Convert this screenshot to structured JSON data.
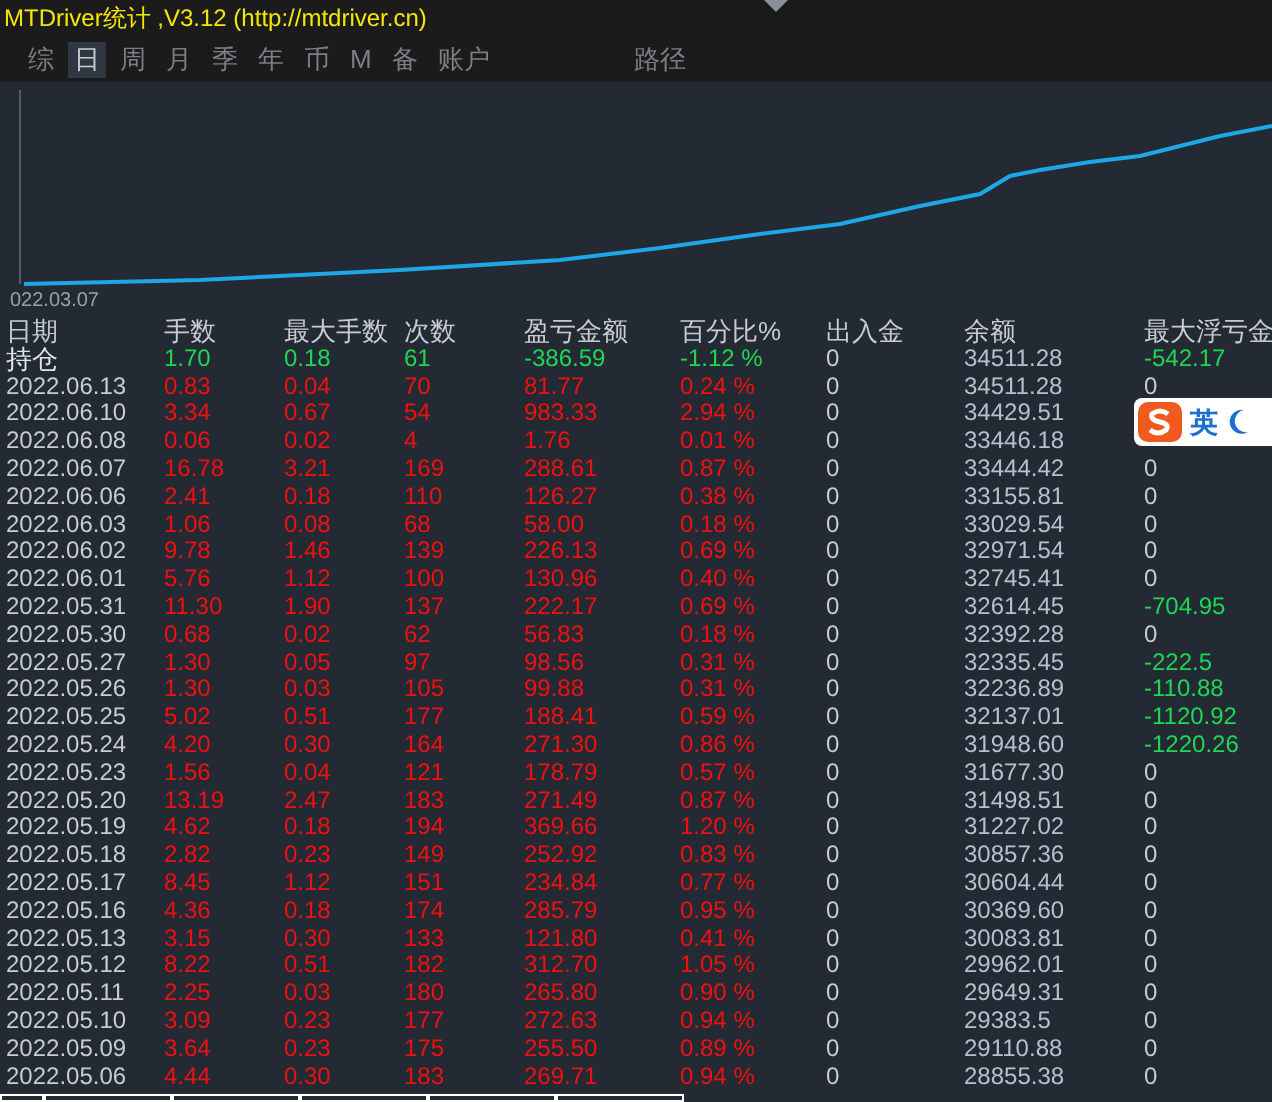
{
  "window": {
    "title": "MTDriver统计 ,V3.12 (http://mtdriver.cn)"
  },
  "tabs": [
    {
      "label": "综",
      "selected": false
    },
    {
      "label": "日",
      "selected": true
    },
    {
      "label": "周",
      "selected": false
    },
    {
      "label": "月",
      "selected": false
    },
    {
      "label": "季",
      "selected": false
    },
    {
      "label": "年",
      "selected": false
    },
    {
      "label": "币",
      "selected": false
    },
    {
      "label": "M",
      "selected": false
    },
    {
      "label": "备",
      "selected": false
    },
    {
      "label": "账户",
      "selected": false
    },
    {
      "label": "路径",
      "selected": false
    }
  ],
  "chart": {
    "start_label": "022.03.07"
  },
  "table": {
    "columns": [
      "日期",
      "手数",
      "最大手数",
      "次数",
      "盈亏金额",
      "百分比%",
      "出入金",
      "余额",
      "最大浮亏金"
    ],
    "rows": [
      {
        "kind": "holding",
        "profit": false,
        "cells": [
          "持仓",
          "1.70",
          "0.18",
          "61",
          "-386.59",
          "-1.12 %",
          "0",
          "34511.28",
          "-542.17"
        ],
        "float_negative": true
      },
      {
        "kind": "day",
        "profit": true,
        "cells": [
          "2022.06.13",
          "0.83",
          "0.04",
          "70",
          "81.77",
          "0.24 %",
          "0",
          "34511.28",
          "0"
        ],
        "float_negative": false
      },
      {
        "kind": "day",
        "profit": true,
        "cells": [
          "2022.06.10",
          "3.34",
          "0.67",
          "54",
          "983.33",
          "2.94 %",
          "0",
          "34429.51"
        ]
      },
      {
        "kind": "day",
        "profit": true,
        "cells": [
          "2022.06.08",
          "0.06",
          "0.02",
          "4",
          "1.76",
          "0.01 %",
          "0",
          "33446.18"
        ]
      },
      {
        "kind": "day",
        "profit": true,
        "cells": [
          "2022.06.07",
          "16.78",
          "3.21",
          "169",
          "288.61",
          "0.87 %",
          "0",
          "33444.42",
          "0"
        ],
        "float_negative": false
      },
      {
        "kind": "day",
        "profit": true,
        "cells": [
          "2022.06.06",
          "2.41",
          "0.18",
          "110",
          "126.27",
          "0.38 %",
          "0",
          "33155.81",
          "0"
        ],
        "float_negative": false
      },
      {
        "kind": "day",
        "profit": true,
        "cells": [
          "2022.06.03",
          "1.06",
          "0.08",
          "68",
          "58.00",
          "0.18 %",
          "0",
          "33029.54",
          "0"
        ],
        "float_negative": false
      },
      {
        "kind": "day",
        "profit": true,
        "cells": [
          "2022.06.02",
          "9.78",
          "1.46",
          "139",
          "226.13",
          "0.69 %",
          "0",
          "32971.54",
          "0"
        ],
        "float_negative": false
      },
      {
        "kind": "day",
        "profit": true,
        "cells": [
          "2022.06.01",
          "5.76",
          "1.12",
          "100",
          "130.96",
          "0.40 %",
          "0",
          "32745.41",
          "0"
        ],
        "float_negative": false
      },
      {
        "kind": "day",
        "profit": true,
        "cells": [
          "2022.05.31",
          "11.30",
          "1.90",
          "137",
          "222.17",
          "0.69 %",
          "0",
          "32614.45",
          "-704.95"
        ],
        "float_negative": true
      },
      {
        "kind": "day",
        "profit": true,
        "cells": [
          "2022.05.30",
          "0.68",
          "0.02",
          "62",
          "56.83",
          "0.18 %",
          "0",
          "32392.28",
          "0"
        ],
        "float_negative": false
      },
      {
        "kind": "day",
        "profit": true,
        "cells": [
          "2022.05.27",
          "1.30",
          "0.05",
          "97",
          "98.56",
          "0.31 %",
          "0",
          "32335.45",
          "-222.5"
        ],
        "float_negative": true
      },
      {
        "kind": "day",
        "profit": true,
        "cells": [
          "2022.05.26",
          "1.30",
          "0.03",
          "105",
          "99.88",
          "0.31 %",
          "0",
          "32236.89",
          "-110.88"
        ],
        "float_negative": true
      },
      {
        "kind": "day",
        "profit": true,
        "cells": [
          "2022.05.25",
          "5.02",
          "0.51",
          "177",
          "188.41",
          "0.59 %",
          "0",
          "32137.01",
          "-1120.92"
        ],
        "float_negative": true
      },
      {
        "kind": "day",
        "profit": true,
        "cells": [
          "2022.05.24",
          "4.20",
          "0.30",
          "164",
          "271.30",
          "0.86 %",
          "0",
          "31948.60",
          "-1220.26"
        ],
        "float_negative": true
      },
      {
        "kind": "day",
        "profit": true,
        "cells": [
          "2022.05.23",
          "1.56",
          "0.04",
          "121",
          "178.79",
          "0.57 %",
          "0",
          "31677.30",
          "0"
        ],
        "float_negative": false
      },
      {
        "kind": "day",
        "profit": true,
        "cells": [
          "2022.05.20",
          "13.19",
          "2.47",
          "183",
          "271.49",
          "0.87 %",
          "0",
          "31498.51",
          "0"
        ],
        "float_negative": false
      },
      {
        "kind": "day",
        "profit": true,
        "cells": [
          "2022.05.19",
          "4.62",
          "0.18",
          "194",
          "369.66",
          "1.20 %",
          "0",
          "31227.02",
          "0"
        ],
        "float_negative": false
      },
      {
        "kind": "day",
        "profit": true,
        "cells": [
          "2022.05.18",
          "2.82",
          "0.23",
          "149",
          "252.92",
          "0.83 %",
          "0",
          "30857.36",
          "0"
        ],
        "float_negative": false
      },
      {
        "kind": "day",
        "profit": true,
        "cells": [
          "2022.05.17",
          "8.45",
          "1.12",
          "151",
          "234.84",
          "0.77 %",
          "0",
          "30604.44",
          "0"
        ],
        "float_negative": false
      },
      {
        "kind": "day",
        "profit": true,
        "cells": [
          "2022.05.16",
          "4.36",
          "0.18",
          "174",
          "285.79",
          "0.95 %",
          "0",
          "30369.60",
          "0"
        ],
        "float_negative": false
      },
      {
        "kind": "day",
        "profit": true,
        "cells": [
          "2022.05.13",
          "3.15",
          "0.30",
          "133",
          "121.80",
          "0.41 %",
          "0",
          "30083.81",
          "0"
        ],
        "float_negative": false
      },
      {
        "kind": "day",
        "profit": true,
        "cells": [
          "2022.05.12",
          "8.22",
          "0.51",
          "182",
          "312.70",
          "1.05 %",
          "0",
          "29962.01",
          "0"
        ],
        "float_negative": false
      },
      {
        "kind": "day",
        "profit": true,
        "cells": [
          "2022.05.11",
          "2.25",
          "0.03",
          "180",
          "265.80",
          "0.90 %",
          "0",
          "29649.31",
          "0"
        ],
        "float_negative": false
      },
      {
        "kind": "day",
        "profit": true,
        "cells": [
          "2022.05.10",
          "3.09",
          "0.23",
          "177",
          "272.63",
          "0.94 %",
          "0",
          "29383.5",
          "0"
        ],
        "float_negative": false
      },
      {
        "kind": "day",
        "profit": true,
        "cells": [
          "2022.05.09",
          "3.64",
          "0.23",
          "175",
          "255.50",
          "0.89 %",
          "0",
          "29110.88",
          "0"
        ],
        "float_negative": false
      },
      {
        "kind": "day",
        "profit": true,
        "cells": [
          "2022.05.06",
          "4.44",
          "0.30",
          "183",
          "269.71",
          "0.94 %",
          "0",
          "28855.38",
          "0"
        ],
        "float_negative": false
      }
    ]
  },
  "ime": {
    "label": "英"
  }
}
